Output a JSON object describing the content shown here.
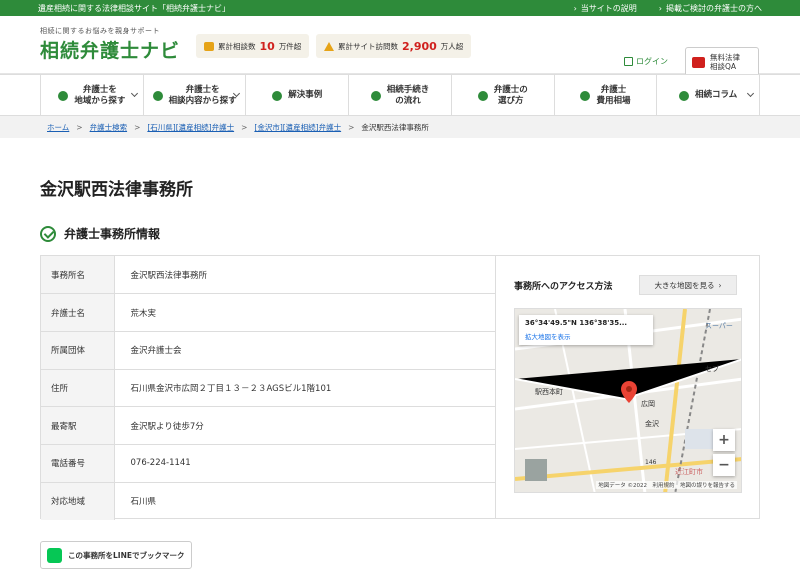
{
  "topbar": {
    "title": "遺産相続に関する法律相談サイト「相続弁護士ナビ」",
    "links": [
      "当サイトの説明",
      "掲載ご検討の弁護士の方へ"
    ]
  },
  "header": {
    "tagline": "相続に関するお悩みを親身サポート",
    "logo": "相続弁護士ナビ",
    "stat1": {
      "label": "累計相談数",
      "value": "10",
      "unit": "万件超"
    },
    "stat2": {
      "label": "累計サイト訪問数",
      "value": "2,900",
      "unit": "万人超"
    },
    "login": "ログイン",
    "qa_line1": "無料法律",
    "qa_line2": "相談QA"
  },
  "nav": [
    {
      "line1": "弁護士を",
      "line2": "地域から探す",
      "icon": "map-pin-icon",
      "chev": true
    },
    {
      "line1": "弁護士を",
      "line2": "相談内容から探す",
      "icon": "chat-icon",
      "chev": true
    },
    {
      "line1": "解決事例",
      "line2": "",
      "icon": "bulb-icon",
      "chev": false
    },
    {
      "line1": "相続手続き",
      "line2": "の流れ",
      "icon": "pencil-doc-icon",
      "chev": false
    },
    {
      "line1": "弁護士の",
      "line2": "選び方",
      "icon": "search-icon",
      "chev": false
    },
    {
      "line1": "弁護士",
      "line2": "費用相場",
      "icon": "yen-icon",
      "chev": false
    },
    {
      "line1": "相続コラム",
      "line2": "",
      "icon": "pen-icon",
      "chev": true
    }
  ],
  "breadcrumb": [
    "ホーム",
    "弁護士検索",
    "[石川県][遺産相続]弁護士",
    "[金沢市][遺産相続]弁護士",
    "金沢駅西法律事務所"
  ],
  "page_title": "金沢駅西法律事務所",
  "section_title": "弁護士事務所情報",
  "info": [
    {
      "key": "事務所名",
      "value": "金沢駅西法律事務所"
    },
    {
      "key": "弁護士名",
      "value": "荒木実"
    },
    {
      "key": "所属団体",
      "value": "金沢弁護士会"
    },
    {
      "key": "住所",
      "value": "石川県金沢市広岡２丁目１３－２３AGSビル1階101"
    },
    {
      "key": "最寄駅",
      "value": "金沢駅より徒歩7分"
    },
    {
      "key": "電話番号",
      "value": "076-224-1141"
    },
    {
      "key": "対応地域",
      "value": "石川県"
    }
  ],
  "access": {
    "title": "事務所へのアクセス方法",
    "big_map": "大きな地図を見る",
    "coord": "36°34'49.5\"N 136°38'35...",
    "enlarge": "拡大地図を表示",
    "labels": {
      "station_town": "駅西本町",
      "hirooka": "広岡",
      "kanazawa": "金沢",
      "omicho": "近江町市",
      "super": "スーパー",
      "seven": "セブ",
      "route": "146"
    },
    "attribution": "地図データ ©2022　利用規約　地図の誤りを報告する"
  },
  "line_button": "この事務所をLINEでブックマーク",
  "colors": {
    "brand": "#2e8b3a",
    "accent": "#d0201d",
    "link": "#1a5fb4"
  }
}
